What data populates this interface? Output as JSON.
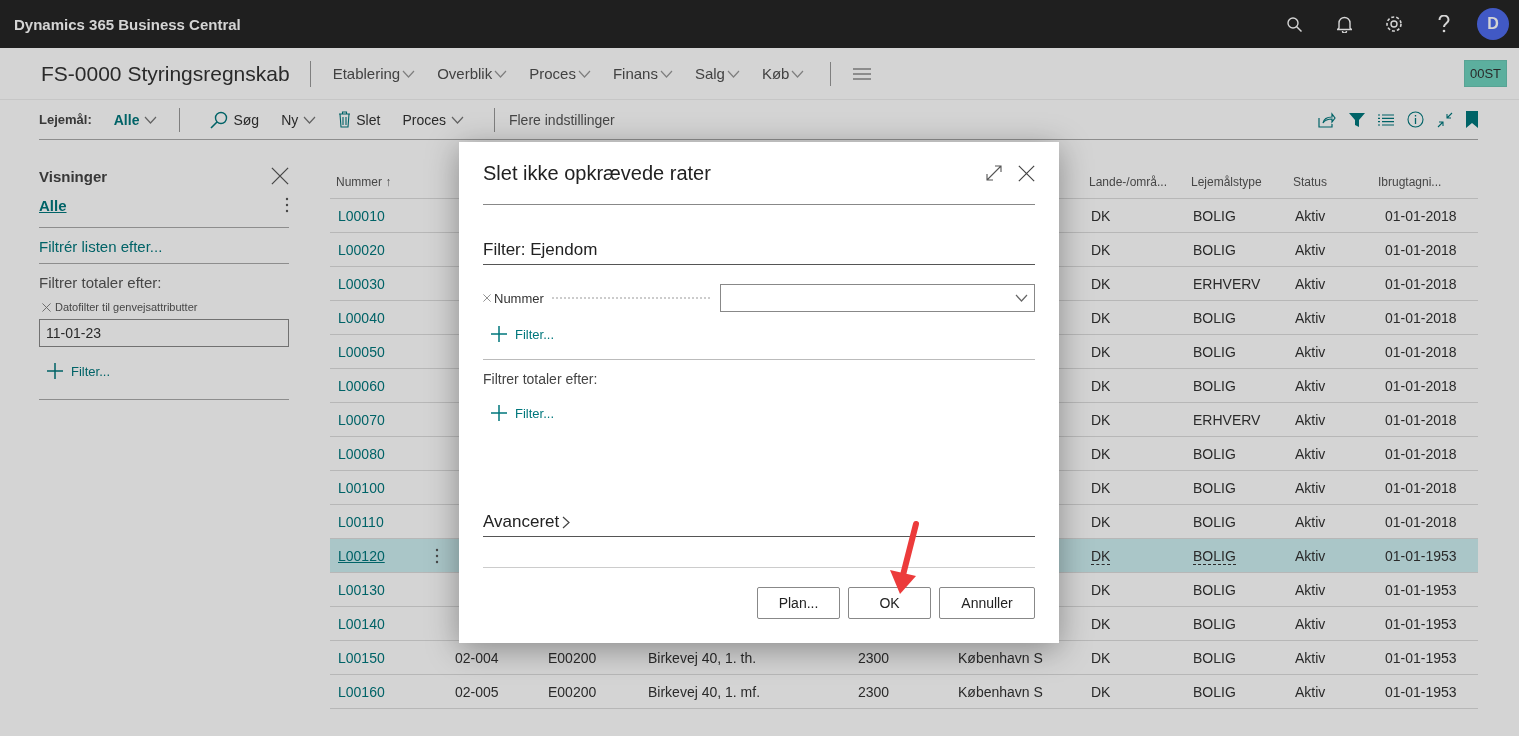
{
  "app": {
    "title": "Dynamics 365 Business Central",
    "avatar": "D"
  },
  "page": {
    "title": "FS-0000 Styringsregnskab",
    "nav": [
      "Etablering",
      "Overblik",
      "Proces",
      "Finans",
      "Salg",
      "Køb"
    ],
    "badge": "00ST"
  },
  "toolbar": {
    "filter_label": "Lejemål:",
    "filter_value": "Alle",
    "actions": [
      {
        "kind": "search",
        "label": "Søg"
      },
      {
        "kind": "dropdown",
        "label": "Ny"
      },
      {
        "kind": "delete",
        "label": "Slet"
      },
      {
        "kind": "dropdown",
        "label": "Proces"
      }
    ],
    "more": "Flere indstillinger"
  },
  "views": {
    "title": "Visninger",
    "items": [
      {
        "label": "Alle",
        "selected": true
      }
    ],
    "filter_list": "Filtrér listen efter...",
    "totals_label": "Filtrer totaler efter:",
    "totals_filters": [
      {
        "label": "Datofilter til genvejsattributter",
        "value": "11-01-23"
      }
    ],
    "add_filter": "Filter..."
  },
  "table": {
    "first_column": "Nummer ↑",
    "columns": [
      "Lande-/områ...",
      "Lejemålstype",
      "Status",
      "Ibrugtagni..."
    ],
    "rows": [
      {
        "nummer": "L00010",
        "selected": false,
        "country": "DK",
        "type": "BOLIG",
        "status": "Aktiv",
        "date": "01-01-2018"
      },
      {
        "nummer": "L00020",
        "selected": false,
        "country": "DK",
        "type": "BOLIG",
        "status": "Aktiv",
        "date": "01-01-2018"
      },
      {
        "nummer": "L00030",
        "selected": false,
        "country": "DK",
        "type": "ERHVERV",
        "status": "Aktiv",
        "date": "01-01-2018"
      },
      {
        "nummer": "L00040",
        "selected": false,
        "country": "DK",
        "type": "BOLIG",
        "status": "Aktiv",
        "date": "01-01-2018"
      },
      {
        "nummer": "L00050",
        "selected": false,
        "country": "DK",
        "type": "BOLIG",
        "status": "Aktiv",
        "date": "01-01-2018"
      },
      {
        "nummer": "L00060",
        "selected": false,
        "country": "DK",
        "type": "BOLIG",
        "status": "Aktiv",
        "date": "01-01-2018"
      },
      {
        "nummer": "L00070",
        "selected": false,
        "country": "DK",
        "type": "ERHVERV",
        "status": "Aktiv",
        "date": "01-01-2018"
      },
      {
        "nummer": "L00080",
        "selected": false,
        "country": "DK",
        "type": "BOLIG",
        "status": "Aktiv",
        "date": "01-01-2018"
      },
      {
        "nummer": "L00100",
        "selected": false,
        "country": "DK",
        "type": "BOLIG",
        "status": "Aktiv",
        "date": "01-01-2018"
      },
      {
        "nummer": "L00110",
        "selected": false,
        "country": "DK",
        "type": "BOLIG",
        "status": "Aktiv",
        "date": "01-01-2018"
      },
      {
        "nummer": "L00120",
        "selected": true,
        "country": "DK",
        "type": "BOLIG",
        "status": "Aktiv",
        "date": "01-01-1953"
      },
      {
        "nummer": "L00130",
        "selected": false,
        "country": "DK",
        "type": "BOLIG",
        "status": "Aktiv",
        "date": "01-01-1953"
      },
      {
        "nummer": "L00140",
        "selected": false,
        "country": "DK",
        "type": "BOLIG",
        "status": "Aktiv",
        "date": "01-01-1953"
      },
      {
        "nummer": "L00150",
        "selected": false,
        "middle": [
          "02-004",
          "E00200",
          "Birkevej 40, 1. th.",
          "2300",
          "København S"
        ],
        "country": "DK",
        "type": "BOLIG",
        "status": "Aktiv",
        "date": "01-01-1953"
      },
      {
        "nummer": "L00160",
        "selected": false,
        "middle": [
          "02-005",
          "E00200",
          "Birkevej 40, 1. mf.",
          "2300",
          "København S"
        ],
        "country": "DK",
        "type": "BOLIG",
        "status": "Aktiv",
        "date": "01-01-1953"
      }
    ]
  },
  "dialog": {
    "title": "Slet ikke opkrævede rater",
    "section": "Filter: Ejendom",
    "filters": [
      {
        "label": "Nummer"
      }
    ],
    "add_filter": "Filter...",
    "totals_label": "Filtrer totaler efter:",
    "totals_add_filter": "Filter...",
    "advanced": {
      "label": "Avanceret",
      "expanded": false
    },
    "buttons": [
      "Plan...",
      "OK",
      "Annuller"
    ]
  }
}
